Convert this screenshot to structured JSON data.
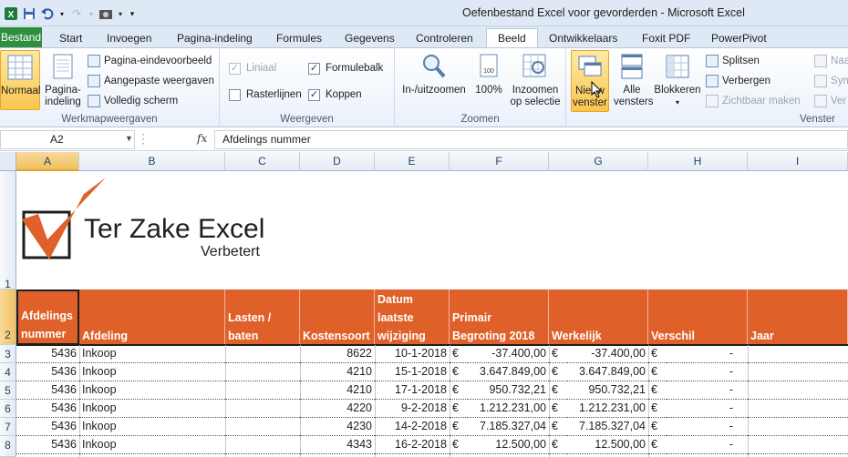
{
  "window": {
    "title": "Oefenbestand Excel voor gevorderden  -  Microsoft Excel"
  },
  "ribbon_tabs": [
    "Bestand",
    "Start",
    "Invoegen",
    "Pagina-indeling",
    "Formules",
    "Gegevens",
    "Controleren",
    "Beeld",
    "Ontwikkelaars",
    "Foxit PDF",
    "PowerPivot"
  ],
  "active_tab": "Beeld",
  "groups": {
    "werkmap": {
      "label": "Werkmapweergaven",
      "normaal": "Normaal",
      "pagina_1": "Pagina-",
      "pagina_2": "indeling",
      "eindevoorbeeld": "Pagina-eindevoorbeeld",
      "aangepast": "Aangepaste weergaven",
      "volledig": "Volledig scherm"
    },
    "weergeven": {
      "label": "Weergeven",
      "liniaal": "Liniaal",
      "formulebalk": "Formulebalk",
      "rasterlijnen": "Rasterlijnen",
      "koppen": "Koppen"
    },
    "zoomen": {
      "label": "Zoomen",
      "inuit": "In-/uitzoomen",
      "pct": "100%",
      "selectie_1": "Inzoomen",
      "selectie_2": "op selectie"
    },
    "venster": {
      "label": "Venster",
      "nieuw_1": "Nieuw",
      "nieuw_2": "venster",
      "alle_1": "Alle",
      "alle_2": "vensters",
      "blokkeren": "Blokkeren",
      "splitsen": "Splitsen",
      "verbergen": "Verbergen",
      "zichtbaar": "Zichtbaar maken",
      "naast": "Naa",
      "sync": "Syn",
      "ver": "Ver"
    }
  },
  "formula_bar": {
    "name_box": "A2",
    "fx": "fx",
    "content": "Afdelings nummer"
  },
  "columns": [
    "A",
    "B",
    "C",
    "D",
    "E",
    "F",
    "G",
    "H",
    "I"
  ],
  "row_numbers": [
    "1",
    "2",
    "3",
    "4",
    "5",
    "6",
    "7",
    "8"
  ],
  "logo": {
    "name": "Ter Zake Excel",
    "tagline": "Verbetert"
  },
  "table_headers": {
    "a": [
      "Afdelings",
      "nummer"
    ],
    "b": "Afdeling",
    "c": [
      "Lasten /",
      "baten"
    ],
    "d": "Kostensoort",
    "e": [
      "Datum",
      "laatste",
      "wijziging"
    ],
    "f": [
      "Primair",
      "Begroting 2018"
    ],
    "g": "Werkelijk",
    "h": "Verschil",
    "i": "Jaar"
  },
  "rows": [
    {
      "nummer": "5436",
      "afdeling": "Inkoop",
      "kostensoort": "8622",
      "datum": "10-1-2018",
      "cur1": "€",
      "begroting": "-37.400,00",
      "cur2": "€",
      "werkelijk": "-37.400,00",
      "cur3": "€",
      "verschil": "-"
    },
    {
      "nummer": "5436",
      "afdeling": "Inkoop",
      "kostensoort": "4210",
      "datum": "15-1-2018",
      "cur1": "€",
      "begroting": "3.647.849,00",
      "cur2": "€",
      "werkelijk": "3.647.849,00",
      "cur3": "€",
      "verschil": "-"
    },
    {
      "nummer": "5436",
      "afdeling": "Inkoop",
      "kostensoort": "4210",
      "datum": "17-1-2018",
      "cur1": "€",
      "begroting": "950.732,21",
      "cur2": "€",
      "werkelijk": "950.732,21",
      "cur3": "€",
      "verschil": "-"
    },
    {
      "nummer": "5436",
      "afdeling": "Inkoop",
      "kostensoort": "4220",
      "datum": "9-2-2018",
      "cur1": "€",
      "begroting": "1.212.231,00",
      "cur2": "€",
      "werkelijk": "1.212.231,00",
      "cur3": "€",
      "verschil": "-"
    },
    {
      "nummer": "5436",
      "afdeling": "Inkoop",
      "kostensoort": "4230",
      "datum": "14-2-2018",
      "cur1": "€",
      "begroting": "7.185.327,04",
      "cur2": "€",
      "werkelijk": "7.185.327,04",
      "cur3": "€",
      "verschil": "-"
    },
    {
      "nummer": "5436",
      "afdeling": "Inkoop",
      "kostensoort": "4343",
      "datum": "16-2-2018",
      "cur1": "€",
      "begroting": "12.500,00",
      "cur2": "€",
      "werkelijk": "12.500,00",
      "cur3": "€",
      "verschil": "-"
    }
  ],
  "colors": {
    "header_fill": "#e06029",
    "file_tab": "#2f8f3f",
    "logo_check": "#e06029"
  }
}
